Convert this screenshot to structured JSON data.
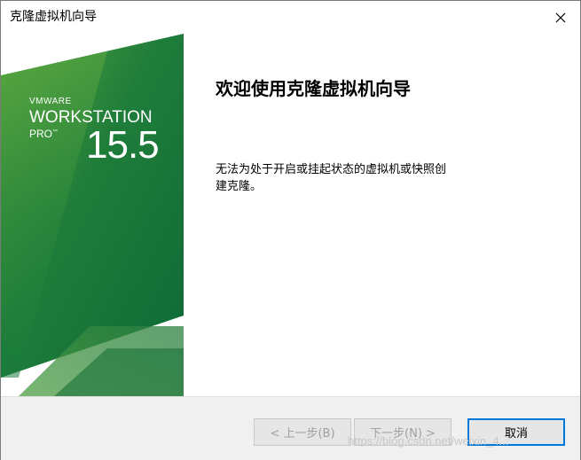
{
  "window": {
    "title": "克隆虚拟机向导",
    "close_icon": "close-icon"
  },
  "banner": {
    "brand": "VMWARE",
    "product": "WORKSTATION",
    "edition": "PRO",
    "trademark": "™",
    "version": "15.5",
    "colors": {
      "light": "#5aa53f",
      "dark": "#0f6b38"
    }
  },
  "content": {
    "heading": "欢迎使用克隆虚拟机向导",
    "description": "无法为处于开启或挂起状态的虚拟机或快照创建克隆。"
  },
  "buttons": {
    "back": "< 上一步(B)",
    "next": "下一步(N) >",
    "cancel": "取消",
    "focus_color": "#0078d7"
  },
  "watermark": "https://blog.csdn.net/weixin_4..."
}
